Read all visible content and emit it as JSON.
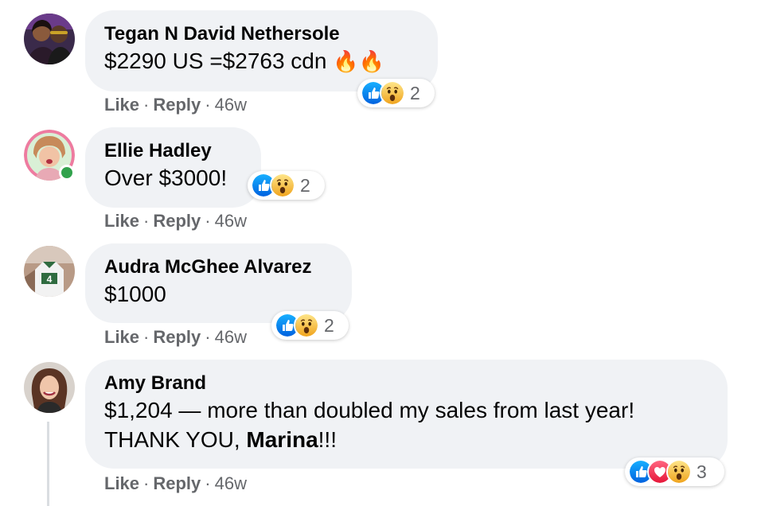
{
  "comments": [
    {
      "author": "Tegan N David Nethersole",
      "text": "$2290 US =$2763 cdn",
      "emoji": "🔥🔥",
      "reaction_count": "2",
      "reactions": [
        "like-icon",
        "wow-icon"
      ],
      "like_label": "Like",
      "reply_label": "Reply",
      "time": "46w"
    },
    {
      "author": "Ellie Hadley",
      "text": "Over $3000!",
      "reaction_count": "2",
      "reactions": [
        "like-icon",
        "wow-icon"
      ],
      "like_label": "Like",
      "reply_label": "Reply",
      "time": "46w",
      "online": true
    },
    {
      "author": "Audra McGhee Alvarez",
      "text": "$1000",
      "reaction_count": "2",
      "reactions": [
        "like-icon",
        "wow-icon"
      ],
      "like_label": "Like",
      "reply_label": "Reply",
      "time": "46w"
    },
    {
      "author": "Amy Brand",
      "text_line1": "$1,204 — more than doubled my sales from last year!",
      "text_line2_prefix": "THANK YOU, ",
      "text_line2_bold": "Marina",
      "text_line2_suffix": "!!!",
      "reaction_count": "3",
      "reactions": [
        "like-icon",
        "love-icon",
        "wow-icon"
      ],
      "like_label": "Like",
      "reply_label": "Reply",
      "time": "46w"
    }
  ],
  "separator": "·",
  "colors": {
    "bubble": "#f0f2f5",
    "meta_text": "#65676b",
    "like_blue": "#1877f2",
    "love_red": "#f33e58",
    "wow_yellow": "#f7b125",
    "online_green": "#31a24c"
  }
}
